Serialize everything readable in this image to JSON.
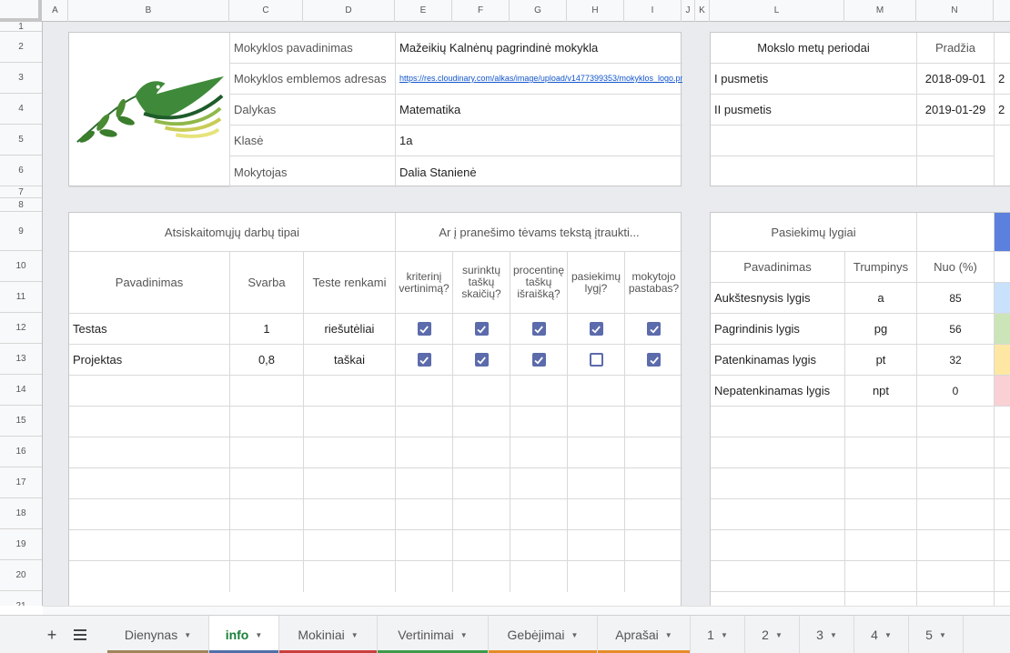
{
  "columns": [
    "A",
    "B",
    "C",
    "D",
    "E",
    "F",
    "G",
    "H",
    "I",
    "J",
    "K",
    "L",
    "M",
    "N"
  ],
  "rows": [
    "1",
    "2",
    "3",
    "4",
    "5",
    "6",
    "7",
    "8",
    "9",
    "10",
    "11",
    "12",
    "13",
    "14",
    "15",
    "16",
    "17",
    "18",
    "19",
    "20",
    "21"
  ],
  "school": {
    "name_label": "Mokyklos pavadinimas",
    "name_value": "Mažeikių Kalnėnų pagrindinė mokykla",
    "logo_label": "Mokyklos emblemos adresas",
    "logo_value": "https://res.cloudinary.com/alkas/image/upload/v1477399353/mokyklos_logo.png",
    "subject_label": "Dalykas",
    "subject_value": "Matematika",
    "class_label": "Klasė",
    "class_value": "1a",
    "teacher_label": "Mokytojas",
    "teacher_value": "Dalia Stanienė"
  },
  "periods": {
    "header": "Mokslo metų periodai",
    "start_header": "Pradžia",
    "rows": [
      {
        "name": "I pusmetis",
        "start": "2018-09-01",
        "end": "2"
      },
      {
        "name": "II pusmetis",
        "start": "2019-01-29",
        "end": "2"
      }
    ]
  },
  "works": {
    "title": "Atsiskaitomųjų darbų tipai",
    "include_title": "Ar į pranešimo tėvams tekstą įtraukti...",
    "col_name": "Pavadinimas",
    "col_weight": "Svarba",
    "col_test": "Teste renkami",
    "col_criteria": "kriterinį vertinimą?",
    "col_points": "surinktų taškų skaičių?",
    "col_percent": "procentinę taškų išraišką?",
    "col_levels": "pasiekimų lygį?",
    "col_notes": "mokytojo pastabas?",
    "rows": [
      {
        "name": "Testas",
        "weight": "1",
        "test": "riešutėliai",
        "checks": [
          true,
          true,
          true,
          true,
          true
        ]
      },
      {
        "name": "Projektas",
        "weight": "0,8",
        "test": "taškai",
        "checks": [
          true,
          true,
          true,
          false,
          true
        ]
      }
    ]
  },
  "levels": {
    "title": "Pasiekimų lygiai",
    "col_name": "Pavadinimas",
    "col_short": "Trumpinys",
    "col_from": "Nuo (%)",
    "rows": [
      {
        "name": "Aukštesnysis lygis",
        "short": "a",
        "from": "85",
        "color": "#c9e1fb"
      },
      {
        "name": "Pagrindinis lygis",
        "short": "pg",
        "from": "56",
        "color": "#cce5b8"
      },
      {
        "name": "Patenkinamas lygis",
        "short": "pt",
        "from": "32",
        "color": "#fde7a3"
      },
      {
        "name": "Nepatenkinamas lygis",
        "short": "npt",
        "from": "0",
        "color": "#f9d0d3"
      }
    ],
    "header_accent": "#5b80dd"
  },
  "tabs": [
    {
      "label": "Dienynas",
      "color": "#a0855b",
      "active": false
    },
    {
      "label": "info",
      "color": "#4f6fa8",
      "active": true
    },
    {
      "label": "Mokiniai",
      "color": "#cc3e3e",
      "active": false
    },
    {
      "label": "Vertinimai",
      "color": "#3d9a4a",
      "active": false
    },
    {
      "label": "Gebėjimai",
      "color": "#e58b28",
      "active": false
    },
    {
      "label": "Aprašai",
      "color": "#e58b28",
      "active": false
    },
    {
      "label": "1",
      "color": "",
      "active": false
    },
    {
      "label": "2",
      "color": "",
      "active": false
    },
    {
      "label": "3",
      "color": "",
      "active": false
    },
    {
      "label": "4",
      "color": "",
      "active": false
    },
    {
      "label": "5",
      "color": "",
      "active": false
    }
  ],
  "icons": {
    "add": "plus-icon",
    "list": "sheet-list-icon",
    "check": "check-icon",
    "caret": "caret-down-icon"
  }
}
